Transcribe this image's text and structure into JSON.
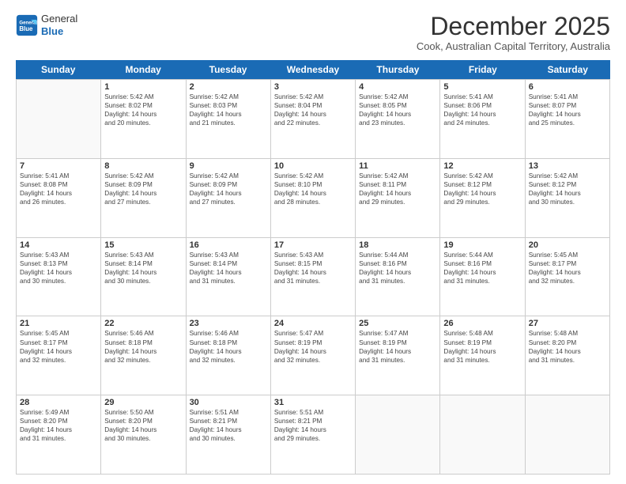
{
  "logo": {
    "general": "General",
    "blue": "Blue"
  },
  "title": "December 2025",
  "subtitle": "Cook, Australian Capital Territory, Australia",
  "days": [
    "Sunday",
    "Monday",
    "Tuesday",
    "Wednesday",
    "Thursday",
    "Friday",
    "Saturday"
  ],
  "weeks": [
    [
      {
        "day": "",
        "lines": []
      },
      {
        "day": "1",
        "lines": [
          "Sunrise: 5:42 AM",
          "Sunset: 8:02 PM",
          "Daylight: 14 hours",
          "and 20 minutes."
        ]
      },
      {
        "day": "2",
        "lines": [
          "Sunrise: 5:42 AM",
          "Sunset: 8:03 PM",
          "Daylight: 14 hours",
          "and 21 minutes."
        ]
      },
      {
        "day": "3",
        "lines": [
          "Sunrise: 5:42 AM",
          "Sunset: 8:04 PM",
          "Daylight: 14 hours",
          "and 22 minutes."
        ]
      },
      {
        "day": "4",
        "lines": [
          "Sunrise: 5:42 AM",
          "Sunset: 8:05 PM",
          "Daylight: 14 hours",
          "and 23 minutes."
        ]
      },
      {
        "day": "5",
        "lines": [
          "Sunrise: 5:41 AM",
          "Sunset: 8:06 PM",
          "Daylight: 14 hours",
          "and 24 minutes."
        ]
      },
      {
        "day": "6",
        "lines": [
          "Sunrise: 5:41 AM",
          "Sunset: 8:07 PM",
          "Daylight: 14 hours",
          "and 25 minutes."
        ]
      }
    ],
    [
      {
        "day": "7",
        "lines": [
          "Sunrise: 5:41 AM",
          "Sunset: 8:08 PM",
          "Daylight: 14 hours",
          "and 26 minutes."
        ]
      },
      {
        "day": "8",
        "lines": [
          "Sunrise: 5:42 AM",
          "Sunset: 8:09 PM",
          "Daylight: 14 hours",
          "and 27 minutes."
        ]
      },
      {
        "day": "9",
        "lines": [
          "Sunrise: 5:42 AM",
          "Sunset: 8:09 PM",
          "Daylight: 14 hours",
          "and 27 minutes."
        ]
      },
      {
        "day": "10",
        "lines": [
          "Sunrise: 5:42 AM",
          "Sunset: 8:10 PM",
          "Daylight: 14 hours",
          "and 28 minutes."
        ]
      },
      {
        "day": "11",
        "lines": [
          "Sunrise: 5:42 AM",
          "Sunset: 8:11 PM",
          "Daylight: 14 hours",
          "and 29 minutes."
        ]
      },
      {
        "day": "12",
        "lines": [
          "Sunrise: 5:42 AM",
          "Sunset: 8:12 PM",
          "Daylight: 14 hours",
          "and 29 minutes."
        ]
      },
      {
        "day": "13",
        "lines": [
          "Sunrise: 5:42 AM",
          "Sunset: 8:12 PM",
          "Daylight: 14 hours",
          "and 30 minutes."
        ]
      }
    ],
    [
      {
        "day": "14",
        "lines": [
          "Sunrise: 5:43 AM",
          "Sunset: 8:13 PM",
          "Daylight: 14 hours",
          "and 30 minutes."
        ]
      },
      {
        "day": "15",
        "lines": [
          "Sunrise: 5:43 AM",
          "Sunset: 8:14 PM",
          "Daylight: 14 hours",
          "and 30 minutes."
        ]
      },
      {
        "day": "16",
        "lines": [
          "Sunrise: 5:43 AM",
          "Sunset: 8:14 PM",
          "Daylight: 14 hours",
          "and 31 minutes."
        ]
      },
      {
        "day": "17",
        "lines": [
          "Sunrise: 5:43 AM",
          "Sunset: 8:15 PM",
          "Daylight: 14 hours",
          "and 31 minutes."
        ]
      },
      {
        "day": "18",
        "lines": [
          "Sunrise: 5:44 AM",
          "Sunset: 8:16 PM",
          "Daylight: 14 hours",
          "and 31 minutes."
        ]
      },
      {
        "day": "19",
        "lines": [
          "Sunrise: 5:44 AM",
          "Sunset: 8:16 PM",
          "Daylight: 14 hours",
          "and 31 minutes."
        ]
      },
      {
        "day": "20",
        "lines": [
          "Sunrise: 5:45 AM",
          "Sunset: 8:17 PM",
          "Daylight: 14 hours",
          "and 32 minutes."
        ]
      }
    ],
    [
      {
        "day": "21",
        "lines": [
          "Sunrise: 5:45 AM",
          "Sunset: 8:17 PM",
          "Daylight: 14 hours",
          "and 32 minutes."
        ]
      },
      {
        "day": "22",
        "lines": [
          "Sunrise: 5:46 AM",
          "Sunset: 8:18 PM",
          "Daylight: 14 hours",
          "and 32 minutes."
        ]
      },
      {
        "day": "23",
        "lines": [
          "Sunrise: 5:46 AM",
          "Sunset: 8:18 PM",
          "Daylight: 14 hours",
          "and 32 minutes."
        ]
      },
      {
        "day": "24",
        "lines": [
          "Sunrise: 5:47 AM",
          "Sunset: 8:19 PM",
          "Daylight: 14 hours",
          "and 32 minutes."
        ]
      },
      {
        "day": "25",
        "lines": [
          "Sunrise: 5:47 AM",
          "Sunset: 8:19 PM",
          "Daylight: 14 hours",
          "and 31 minutes."
        ]
      },
      {
        "day": "26",
        "lines": [
          "Sunrise: 5:48 AM",
          "Sunset: 8:19 PM",
          "Daylight: 14 hours",
          "and 31 minutes."
        ]
      },
      {
        "day": "27",
        "lines": [
          "Sunrise: 5:48 AM",
          "Sunset: 8:20 PM",
          "Daylight: 14 hours",
          "and 31 minutes."
        ]
      }
    ],
    [
      {
        "day": "28",
        "lines": [
          "Sunrise: 5:49 AM",
          "Sunset: 8:20 PM",
          "Daylight: 14 hours",
          "and 31 minutes."
        ]
      },
      {
        "day": "29",
        "lines": [
          "Sunrise: 5:50 AM",
          "Sunset: 8:20 PM",
          "Daylight: 14 hours",
          "and 30 minutes."
        ]
      },
      {
        "day": "30",
        "lines": [
          "Sunrise: 5:51 AM",
          "Sunset: 8:21 PM",
          "Daylight: 14 hours",
          "and 30 minutes."
        ]
      },
      {
        "day": "31",
        "lines": [
          "Sunrise: 5:51 AM",
          "Sunset: 8:21 PM",
          "Daylight: 14 hours",
          "and 29 minutes."
        ]
      },
      {
        "day": "",
        "lines": []
      },
      {
        "day": "",
        "lines": []
      },
      {
        "day": "",
        "lines": []
      }
    ]
  ]
}
